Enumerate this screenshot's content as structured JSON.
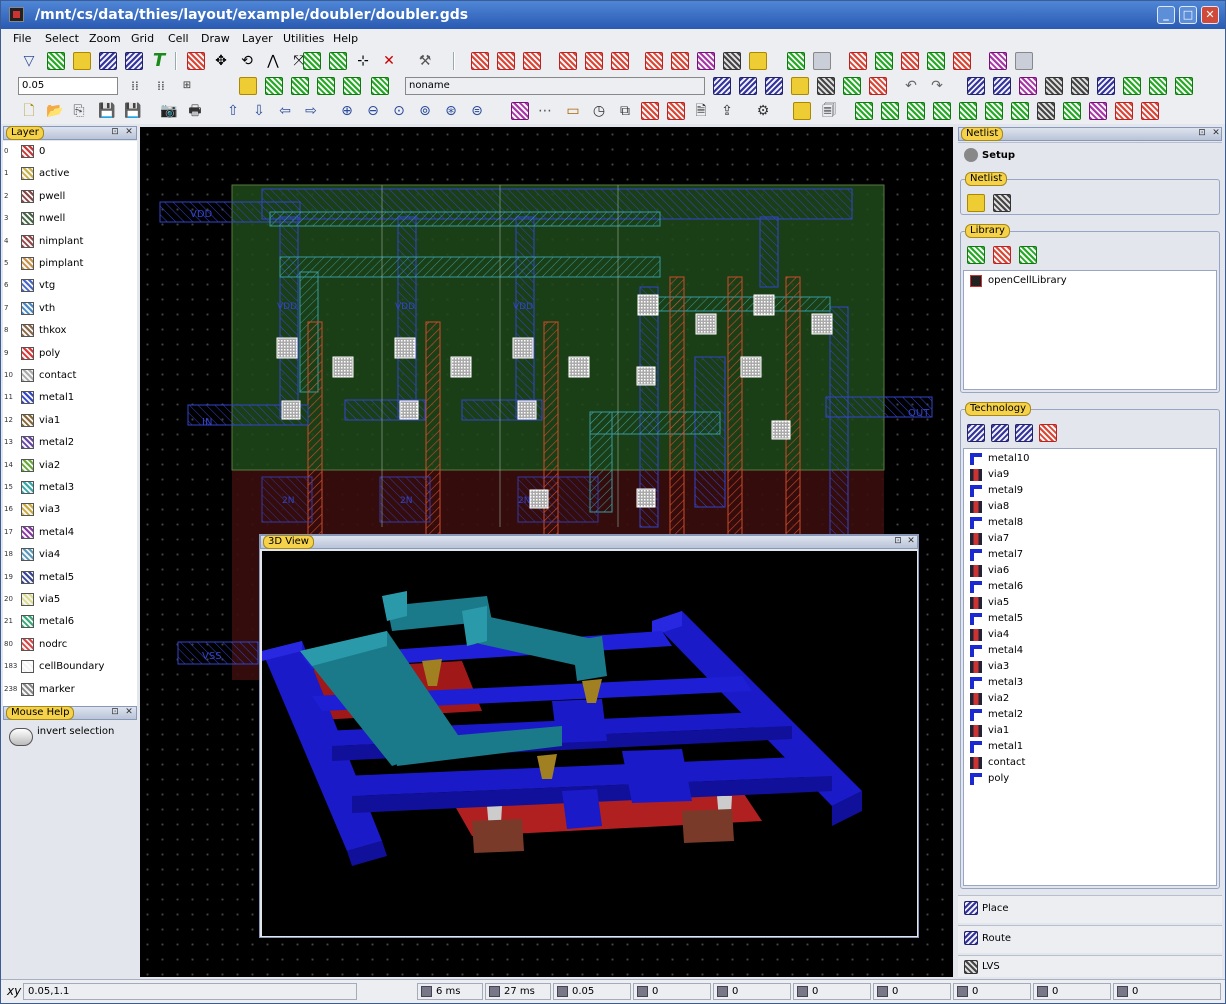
{
  "window": {
    "title": "/mnt/cs/data/thies/layout/example/doubler/doubler.gds",
    "controls": [
      "_",
      "□",
      "✕"
    ]
  },
  "menubar": [
    "File",
    "Select",
    "Zoom",
    "Grid",
    "Cell",
    "Draw",
    "Layer",
    "Utilities",
    "Help"
  ],
  "toolbar": {
    "grid_value": "0.05",
    "cell_name": "noname"
  },
  "layer_panel": {
    "title": "Layer",
    "layers": [
      {
        "num": "0",
        "name": "0",
        "color": "#cc3333"
      },
      {
        "num": "1",
        "name": "active",
        "color": "#c8b040"
      },
      {
        "num": "2",
        "name": "pwell",
        "color": "#884444"
      },
      {
        "num": "3",
        "name": "nwell",
        "color": "#446644"
      },
      {
        "num": "4",
        "name": "nimplant",
        "color": "#994444"
      },
      {
        "num": "5",
        "name": "pimplant",
        "color": "#c89040"
      },
      {
        "num": "6",
        "name": "vtg",
        "color": "#4466cc"
      },
      {
        "num": "7",
        "name": "vth",
        "color": "#4488cc"
      },
      {
        "num": "8",
        "name": "thkox",
        "color": "#886644"
      },
      {
        "num": "9",
        "name": "poly",
        "color": "#dd3333"
      },
      {
        "num": "10",
        "name": "contact",
        "color": "#aaaaaa"
      },
      {
        "num": "11",
        "name": "metal1",
        "color": "#3344cc"
      },
      {
        "num": "12",
        "name": "via1",
        "color": "#886633"
      },
      {
        "num": "13",
        "name": "metal2",
        "color": "#6644aa"
      },
      {
        "num": "14",
        "name": "via2",
        "color": "#66aa33"
      },
      {
        "num": "15",
        "name": "metal3",
        "color": "#33aaaa"
      },
      {
        "num": "16",
        "name": "via3",
        "color": "#ccaa33"
      },
      {
        "num": "17",
        "name": "metal4",
        "color": "#8833aa"
      },
      {
        "num": "18",
        "name": "via4",
        "color": "#5599bb"
      },
      {
        "num": "19",
        "name": "metal5",
        "color": "#334499"
      },
      {
        "num": "20",
        "name": "via5",
        "color": "#dddd88"
      },
      {
        "num": "21",
        "name": "metal6",
        "color": "#33aa77"
      },
      {
        "num": "80",
        "name": "nodrc",
        "color": "#dd4444"
      },
      {
        "num": "183",
        "name": "cellBoundary",
        "color": "#ffffff"
      },
      {
        "num": "238",
        "name": "marker",
        "color": "#888888"
      }
    ]
  },
  "mouse_help": {
    "title": "Mouse Help",
    "text": "invert selection"
  },
  "layout_labels": {
    "vdd": "VDD",
    "vss": "VSS",
    "in": "IN",
    "out": "OUT",
    "cells": [
      "VDD",
      "VDD",
      "VDD",
      "2N",
      "2N",
      "2N"
    ]
  },
  "view3d": {
    "title": "3D View"
  },
  "right_panel": {
    "title": "Netlist",
    "tab_setup": "Setup",
    "netlist_group": "Netlist",
    "library_group": "Library",
    "library_items": [
      "openCellLibrary"
    ],
    "technology_group": "Technology",
    "technology_items": [
      {
        "name": "metal10",
        "kind": "metal"
      },
      {
        "name": "via9",
        "kind": "via"
      },
      {
        "name": "metal9",
        "kind": "metal"
      },
      {
        "name": "via8",
        "kind": "via"
      },
      {
        "name": "metal8",
        "kind": "metal"
      },
      {
        "name": "via7",
        "kind": "via"
      },
      {
        "name": "metal7",
        "kind": "metal"
      },
      {
        "name": "via6",
        "kind": "via"
      },
      {
        "name": "metal6",
        "kind": "metal"
      },
      {
        "name": "via5",
        "kind": "via"
      },
      {
        "name": "metal5",
        "kind": "metal"
      },
      {
        "name": "via4",
        "kind": "via"
      },
      {
        "name": "metal4",
        "kind": "metal"
      },
      {
        "name": "via3",
        "kind": "via"
      },
      {
        "name": "metal3",
        "kind": "metal"
      },
      {
        "name": "via2",
        "kind": "via"
      },
      {
        "name": "metal2",
        "kind": "metal"
      },
      {
        "name": "via1",
        "kind": "via"
      },
      {
        "name": "metal1",
        "kind": "metal"
      },
      {
        "name": "contact",
        "kind": "via"
      },
      {
        "name": "poly",
        "kind": "metal"
      }
    ],
    "tabs": [
      "Place",
      "Route",
      "LVS"
    ]
  },
  "statusbar": {
    "coord_label": "xy",
    "coords": "0.05,1.1",
    "time1": "6 ms",
    "time2": "27 ms",
    "grid": "0.05",
    "counters": [
      "0",
      "0",
      "0",
      "0",
      "0",
      "0",
      "0"
    ]
  }
}
